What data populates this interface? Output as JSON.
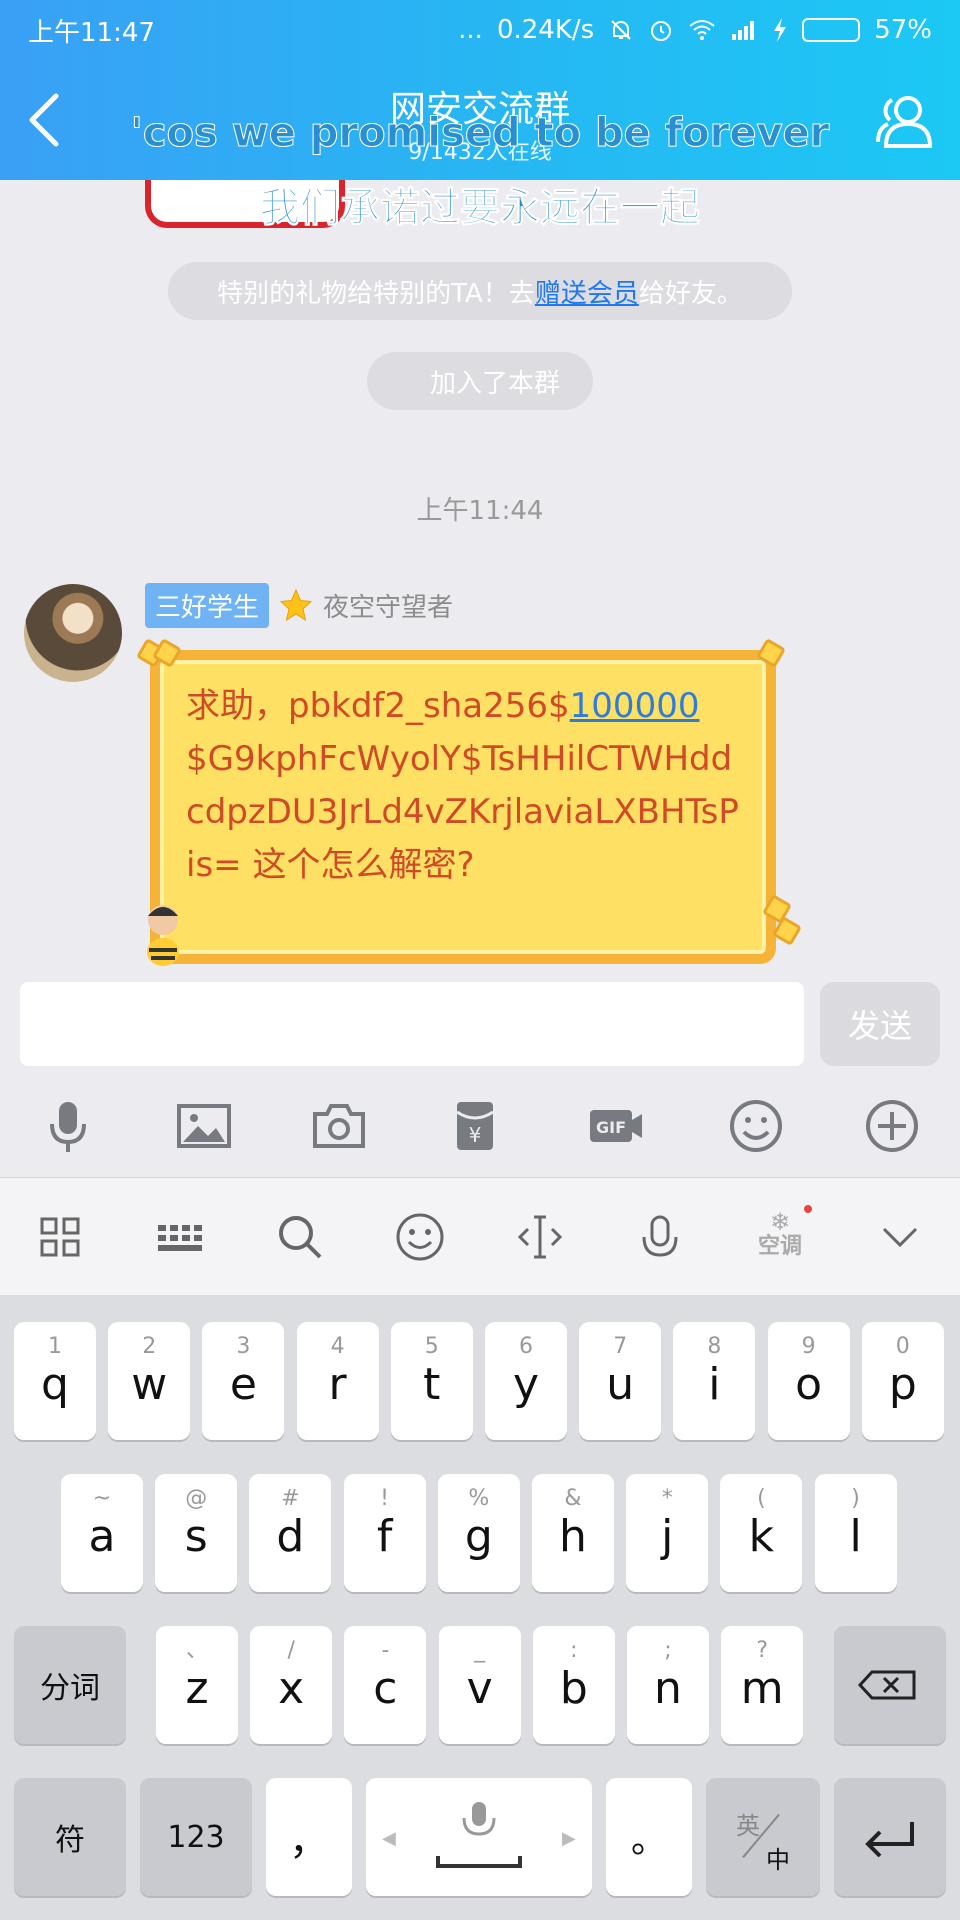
{
  "status": {
    "time": "上午11:47",
    "dots": "...",
    "speed": "0.24K/s",
    "battery_percent": "57%",
    "battery_level": 0.57
  },
  "header": {
    "title": "网安交流群",
    "subtitle": "9/1432人在线"
  },
  "lyrics": {
    "en": "'cos we promised to be forever",
    "cn": "我们承诺过要永远在一起"
  },
  "chat": {
    "gift_notice": {
      "before": "特别的礼物给特别的TA！去",
      "link": "赠送会员",
      "after": "给好友。"
    },
    "join_notice": "加入了本群",
    "timestamp": "上午11:44",
    "message": {
      "badge": "三好学生",
      "nickname": "夜空守望者",
      "text_before": "求助，pbkdf2_sha256$",
      "text_link": "100000",
      "text_after": "$G9kphFcWyolY$TsHHilCTWHddcdpzDU3JrLd4vZKrjlaviaLXBHTsPis= 这个怎么解密?"
    }
  },
  "input": {
    "value": "",
    "send_label": "发送"
  },
  "keyboard": {
    "ac_label": "空调",
    "row1": [
      {
        "hint": "1",
        "ch": "q"
      },
      {
        "hint": "2",
        "ch": "w"
      },
      {
        "hint": "3",
        "ch": "e"
      },
      {
        "hint": "4",
        "ch": "r"
      },
      {
        "hint": "5",
        "ch": "t"
      },
      {
        "hint": "6",
        "ch": "y"
      },
      {
        "hint": "7",
        "ch": "u"
      },
      {
        "hint": "8",
        "ch": "i"
      },
      {
        "hint": "9",
        "ch": "o"
      },
      {
        "hint": "0",
        "ch": "p"
      }
    ],
    "row2": [
      {
        "hint": "~",
        "ch": "a"
      },
      {
        "hint": "@",
        "ch": "s"
      },
      {
        "hint": "#",
        "ch": "d"
      },
      {
        "hint": "!",
        "ch": "f"
      },
      {
        "hint": "%",
        "ch": "g"
      },
      {
        "hint": "&",
        "ch": "h"
      },
      {
        "hint": "*",
        "ch": "j"
      },
      {
        "hint": "(",
        "ch": "k"
      },
      {
        "hint": ")",
        "ch": "l"
      }
    ],
    "row3": [
      {
        "hint": "、",
        "ch": "z"
      },
      {
        "hint": "/",
        "ch": "x"
      },
      {
        "hint": "-",
        "ch": "c"
      },
      {
        "hint": "_",
        "ch": "v"
      },
      {
        "hint": ":",
        "ch": "b"
      },
      {
        "hint": ";",
        "ch": "n"
      },
      {
        "hint": "?",
        "ch": "m"
      }
    ],
    "segment_label": "分词",
    "symbol_label": "符",
    "num_label": "123",
    "comma": "，",
    "period": "。",
    "lang_top": "英",
    "lang_bottom": "中"
  }
}
